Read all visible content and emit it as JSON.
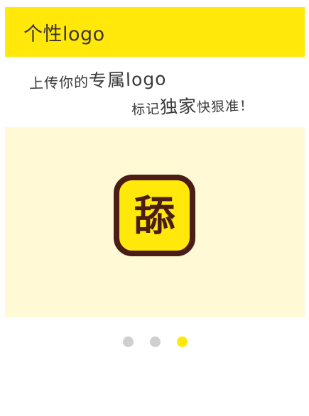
{
  "header": {
    "title": "个性logo"
  },
  "tagline": {
    "line1_a": "上传你的",
    "line1_b": "专属logo",
    "line2_a": "标记",
    "line2_b": "独家",
    "line2_c": "快狠准！"
  },
  "banner": {
    "logo_char": "舔"
  },
  "pager": {
    "count": 3,
    "active_index": 2,
    "colors": {
      "active": "#ffe80a",
      "inactive": "#cfcfcf"
    }
  },
  "colors": {
    "accent": "#ffe80a",
    "banner_bg": "#fff9d6",
    "logo_border": "#4a1d17"
  }
}
